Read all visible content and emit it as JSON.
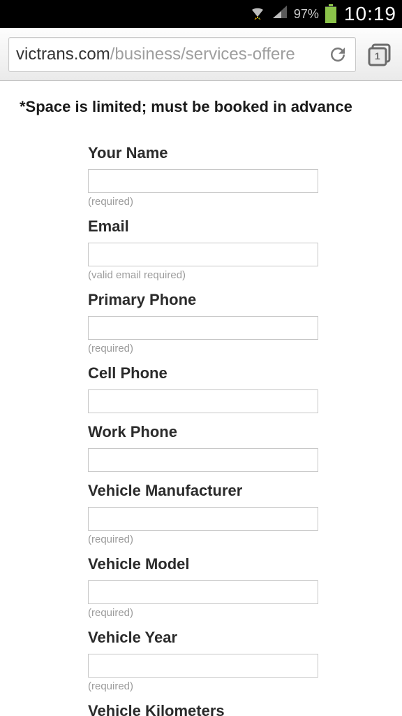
{
  "status": {
    "battery_pct": "97%",
    "time": "10:19"
  },
  "browser": {
    "url_host": "victrans.com",
    "url_path": "/business/services-offere",
    "tab_count": "1"
  },
  "page": {
    "notice": "*Space is limited; must be booked in advance"
  },
  "form": {
    "fields": [
      {
        "label": "Your Name",
        "hint": "(required)"
      },
      {
        "label": "Email",
        "hint": "(valid email required)"
      },
      {
        "label": "Primary Phone",
        "hint": "(required)"
      },
      {
        "label": "Cell Phone",
        "hint": ""
      },
      {
        "label": "Work Phone",
        "hint": ""
      },
      {
        "label": "Vehicle Manufacturer",
        "hint": "(required)"
      },
      {
        "label": "Vehicle Model",
        "hint": "(required)"
      },
      {
        "label": "Vehicle Year",
        "hint": "(required)"
      },
      {
        "label": "Vehicle Kilometers",
        "hint": ""
      }
    ]
  }
}
